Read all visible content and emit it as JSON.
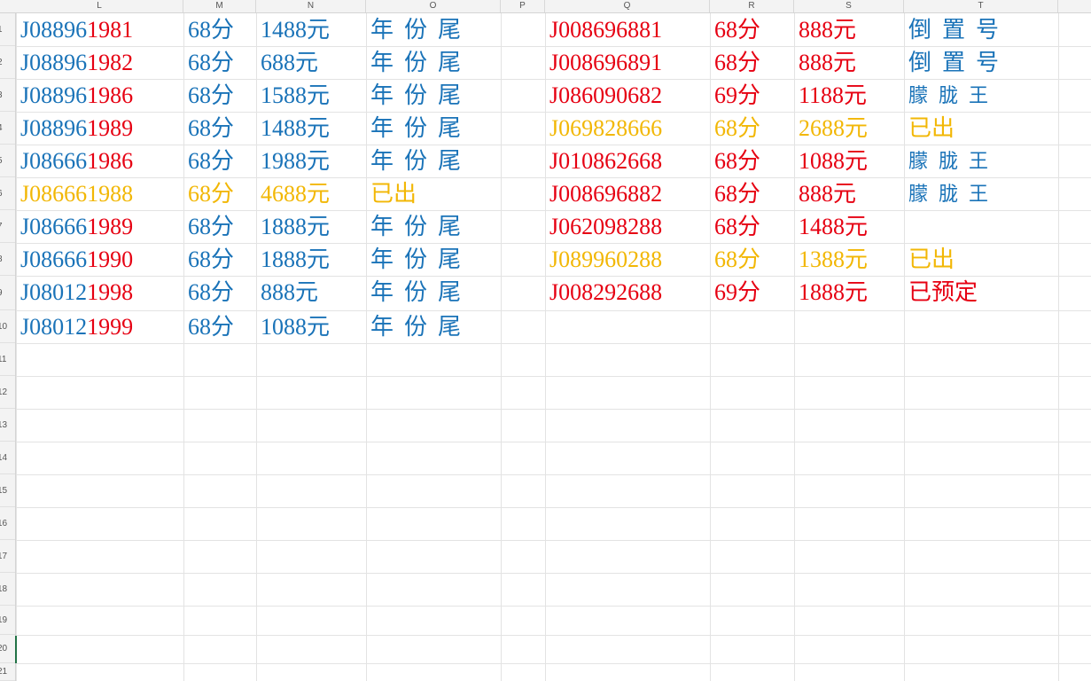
{
  "colors": {
    "blue": "#1a73b8",
    "red": "#e60012",
    "gold": "#f2b705"
  },
  "columns": [
    "L",
    "M",
    "N",
    "O",
    "P",
    "Q",
    "R",
    "S",
    "T"
  ],
  "row_numbers": [
    "1",
    "2",
    "3",
    "4",
    "5",
    "6",
    "7",
    "8",
    "9",
    "10",
    "11",
    "12",
    "13",
    "14",
    "15",
    "16",
    "17",
    "18",
    "19",
    "20",
    "21"
  ],
  "left_table": [
    {
      "num_prefix": "J08896",
      "num_suffix": "1981",
      "points": "68分",
      "price": "1488元",
      "note": "年份尾",
      "color": "blue"
    },
    {
      "num_prefix": "J08896",
      "num_suffix": "1982",
      "points": "68分",
      "price": "688元",
      "note": "年份尾",
      "color": "blue"
    },
    {
      "num_prefix": "J08896",
      "num_suffix": "1986",
      "points": "68分",
      "price": "1588元",
      "note": "年份尾",
      "color": "blue"
    },
    {
      "num_prefix": "J08896",
      "num_suffix": "1989",
      "points": "68分",
      "price": "1488元",
      "note": "年份尾",
      "color": "blue"
    },
    {
      "num_prefix": "J08666",
      "num_suffix": "1986",
      "points": "68分",
      "price": "1988元",
      "note": "年份尾",
      "color": "blue"
    },
    {
      "num_prefix": "J08666",
      "num_suffix": "1988",
      "points": "68分",
      "price": "4688元",
      "note": "已出",
      "color": "gold"
    },
    {
      "num_prefix": "J08666",
      "num_suffix": "1989",
      "points": "68分",
      "price": "1888元",
      "note": "年份尾",
      "color": "blue"
    },
    {
      "num_prefix": "J08666",
      "num_suffix": "1990",
      "points": "68分",
      "price": "1888元",
      "note": "年份尾",
      "color": "blue"
    },
    {
      "num_prefix": "J08012",
      "num_suffix": "1998",
      "points": "68分",
      "price": "888元",
      "note": "年份尾",
      "color": "blue"
    },
    {
      "num_prefix": "J08012",
      "num_suffix": "1999",
      "points": "68分",
      "price": "1088元",
      "note": "年份尾",
      "color": "blue"
    }
  ],
  "right_table": [
    {
      "number": "J008696881",
      "points": "68分",
      "price": "888元",
      "note": "倒置号",
      "color": "red",
      "note_color": "blue"
    },
    {
      "number": "J008696891",
      "points": "68分",
      "price": "888元",
      "note": "倒置号",
      "color": "red",
      "note_color": "blue"
    },
    {
      "number": "J086090682",
      "points": "69分",
      "price": "1188元",
      "note": "朦胧王",
      "color": "red",
      "note_color": "blue"
    },
    {
      "number": "J069828666",
      "points": "68分",
      "price": "2688元",
      "note": "已出",
      "color": "gold",
      "note_color": "gold"
    },
    {
      "number": "J010862668",
      "points": "68分",
      "price": "1088元",
      "note": "朦胧王",
      "color": "red",
      "note_color": "blue"
    },
    {
      "number": "J008696882",
      "points": "68分",
      "price": "888元",
      "note": "朦胧王",
      "color": "red",
      "note_color": "blue"
    },
    {
      "number": "J062098288",
      "points": "68分",
      "price": "1488元",
      "note": "",
      "color": "red",
      "note_color": "blue"
    },
    {
      "number": "J089960288",
      "points": "68分",
      "price": "1388元",
      "note": "已出",
      "color": "gold",
      "note_color": "gold"
    },
    {
      "number": "J008292688",
      "points": "69分",
      "price": "1888元",
      "note": "已预定",
      "color": "red",
      "note_color": "red"
    }
  ]
}
